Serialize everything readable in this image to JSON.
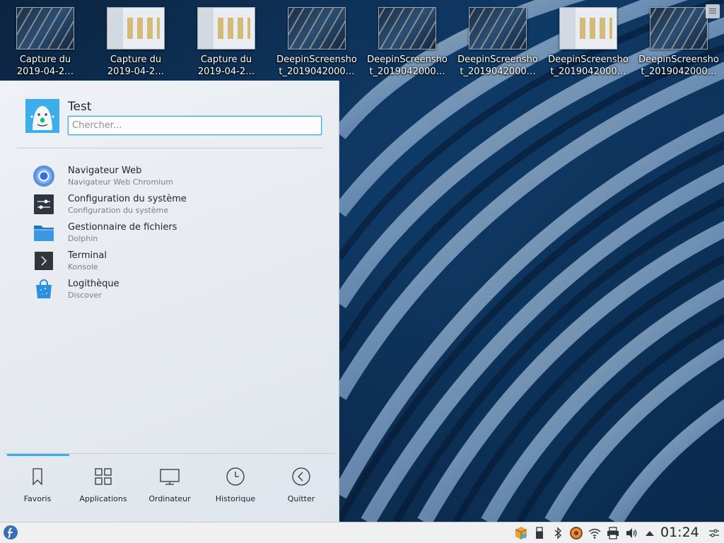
{
  "desktop": {
    "icons": [
      {
        "label": "Capture du\n2019-04-2…",
        "thumb": "dark"
      },
      {
        "label": "Capture du\n2019-04-2…",
        "thumb": "light"
      },
      {
        "label": "Capture du\n2019-04-2…",
        "thumb": "light"
      },
      {
        "label": "DeepinScreensho\nt_2019042000…",
        "thumb": "dark"
      },
      {
        "label": "DeepinScreensho\nt_2019042000…",
        "thumb": "dark"
      },
      {
        "label": "DeepinScreensho\nt_2019042000…",
        "thumb": "dark"
      },
      {
        "label": "DeepinScreensho\nt_2019042000…",
        "thumb": "light"
      },
      {
        "label": "DeepinScreensho\nt_2019042000…",
        "thumb": "dark"
      }
    ]
  },
  "launcher": {
    "user_name": "Test",
    "search": {
      "placeholder": "Chercher...",
      "value": ""
    },
    "favorites": [
      {
        "name": "Navigateur Web",
        "description": "Navigateur Web Chromium",
        "icon": "chromium-icon"
      },
      {
        "name": "Configuration du système",
        "description": "Configuration du système",
        "icon": "system-settings-icon"
      },
      {
        "name": "Gestionnaire de fichiers",
        "description": "Dolphin",
        "icon": "folder-icon"
      },
      {
        "name": "Terminal",
        "description": "Konsole",
        "icon": "terminal-icon"
      },
      {
        "name": "Logithèque",
        "description": "Discover",
        "icon": "discover-bag-icon"
      }
    ],
    "tabs": [
      {
        "label": "Favoris",
        "icon": "bookmark-icon",
        "active": true
      },
      {
        "label": "Applications",
        "icon": "grid-icon",
        "active": false
      },
      {
        "label": "Ordinateur",
        "icon": "monitor-icon",
        "active": false
      },
      {
        "label": "Historique",
        "icon": "clock-icon",
        "active": false
      },
      {
        "label": "Quitter",
        "icon": "back-arrow-icon",
        "active": false
      }
    ]
  },
  "taskbar": {
    "clock": "01:24",
    "tray_icons": [
      "package-updates-icon",
      "usb-device-icon",
      "bluetooth-icon",
      "firefox-sync-icon",
      "wifi-icon",
      "printer-icon",
      "volume-icon",
      "expand-tray-icon",
      "panel-settings-icon"
    ]
  },
  "colors": {
    "accent": "#3daee9",
    "text": "#232629",
    "subtext": "#7a8087"
  }
}
